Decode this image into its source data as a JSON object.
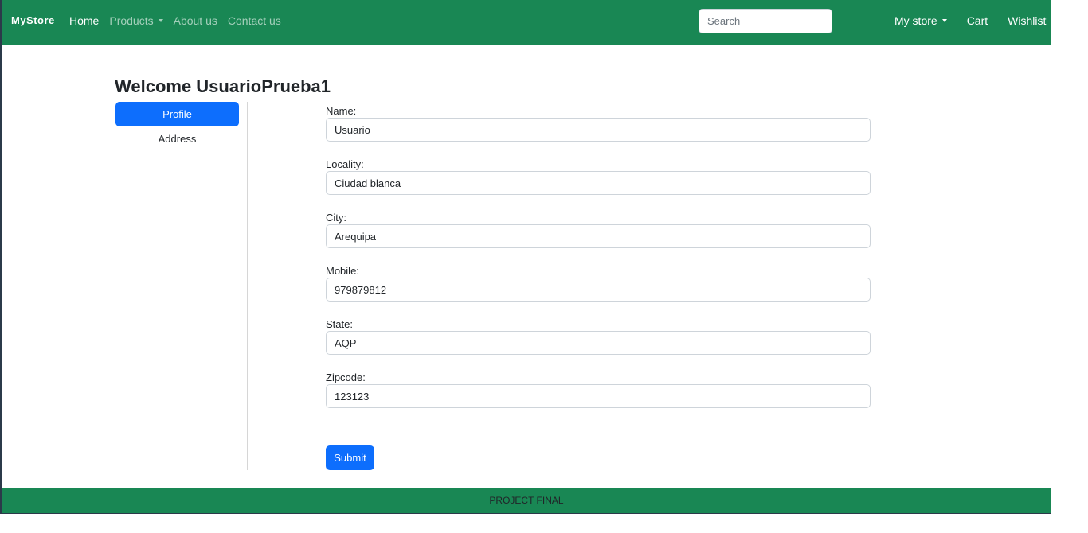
{
  "navbar": {
    "brand": "MyStore",
    "links": [
      {
        "label": "Home"
      },
      {
        "label": "Products"
      },
      {
        "label": "About us"
      },
      {
        "label": "Contact us"
      }
    ],
    "search_placeholder": "Search",
    "right_links": [
      {
        "label": "My store"
      },
      {
        "label": "Cart"
      },
      {
        "label": "Wishlist"
      }
    ]
  },
  "page": {
    "welcome": "Welcome UsuarioPrueba1"
  },
  "sidebar": {
    "items": [
      {
        "label": "Profile"
      },
      {
        "label": "Address"
      }
    ]
  },
  "form": {
    "fields": [
      {
        "label": "Name:",
        "value": "Usuario"
      },
      {
        "label": "Locality:",
        "value": "Ciudad blanca"
      },
      {
        "label": "City:",
        "value": "Arequipa"
      },
      {
        "label": "Mobile:",
        "value": "979879812"
      },
      {
        "label": "State:",
        "value": "AQP"
      },
      {
        "label": "Zipcode:",
        "value": "123123"
      }
    ],
    "submit_label": "Submit"
  },
  "footer": {
    "text": "PROJECT FINAL"
  },
  "colors": {
    "navbar_bg": "#198754",
    "primary": "#0d6efd"
  }
}
